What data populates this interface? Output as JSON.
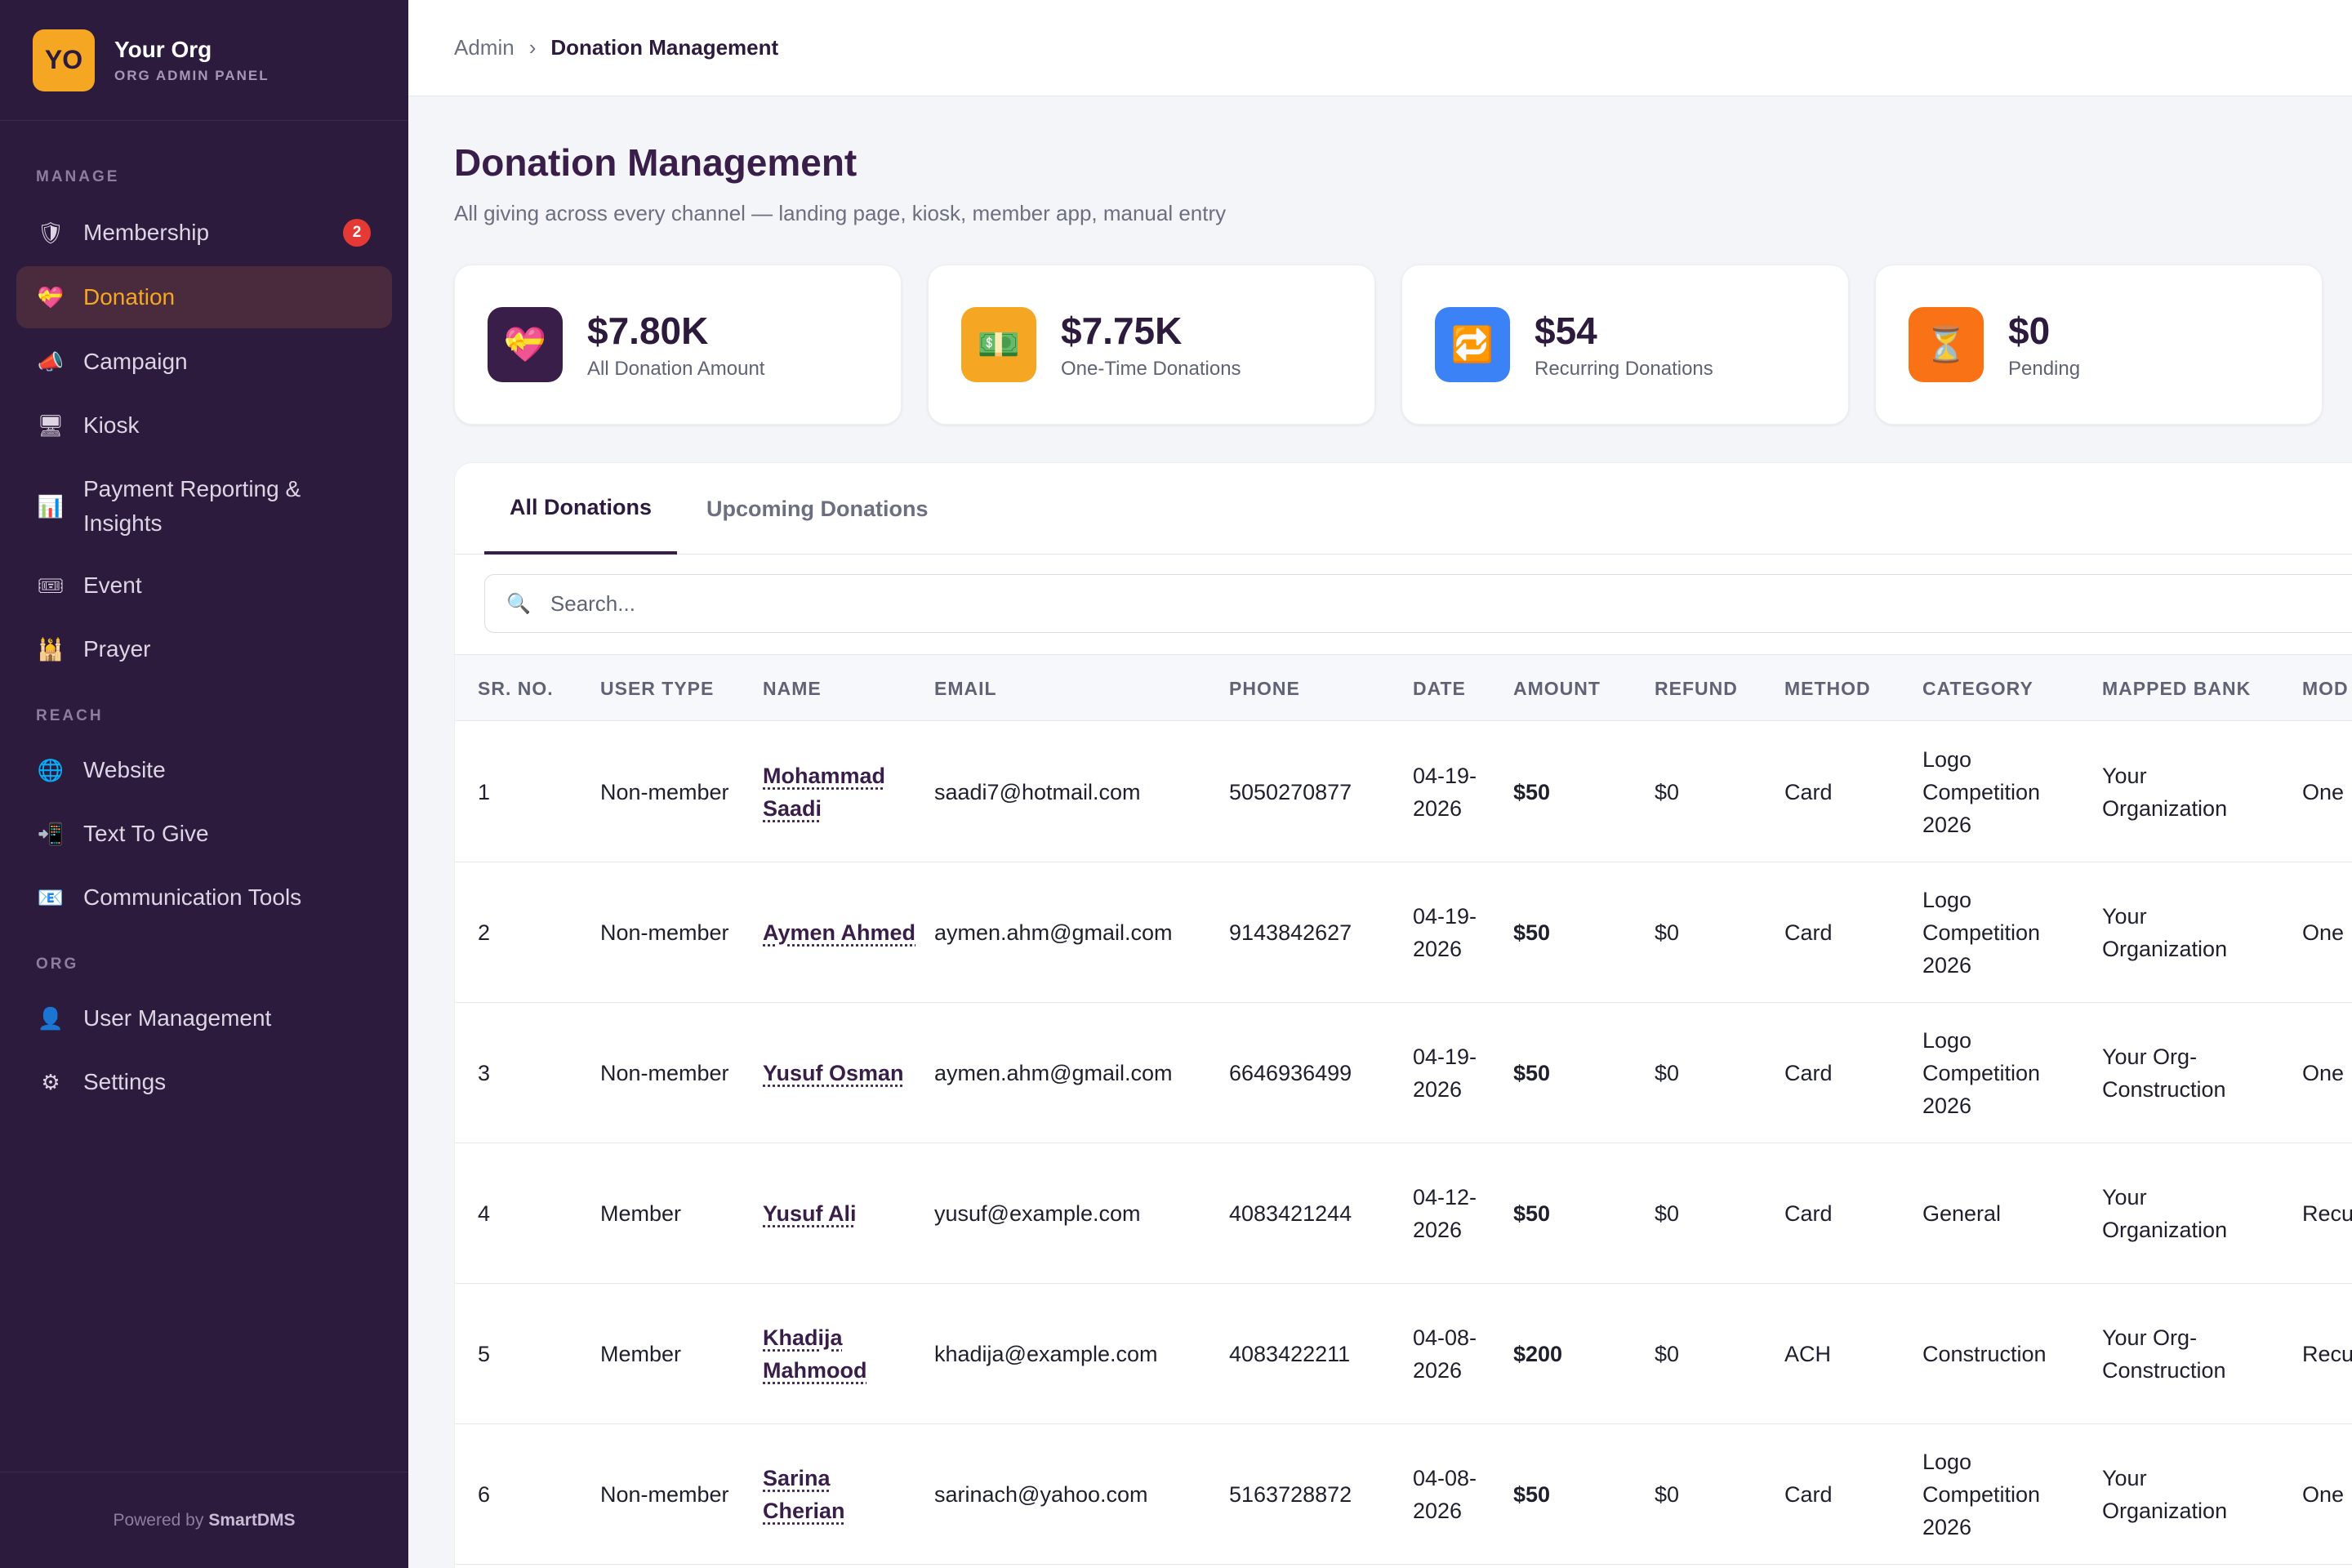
{
  "brand": {
    "logo": "YO",
    "name": "Your Org",
    "subtitle": "ORG ADMIN PANEL"
  },
  "sidebar": {
    "sections": [
      {
        "label": "MANAGE"
      },
      {
        "label": "REACH"
      },
      {
        "label": "ORG"
      }
    ],
    "items": [
      {
        "label": "Membership",
        "icon": "shield-icon",
        "glyph": "🛡",
        "badge": "2",
        "active": false
      },
      {
        "label": "Donation",
        "icon": "heart-gift-icon",
        "glyph": "💝",
        "active": true
      },
      {
        "label": "Campaign",
        "icon": "megaphone-icon",
        "glyph": "📣",
        "active": false
      },
      {
        "label": "Kiosk",
        "icon": "monitor-icon",
        "glyph": "🖥",
        "active": false
      },
      {
        "label": "Payment Reporting & Insights",
        "icon": "bar-chart-icon",
        "glyph": "📊",
        "active": false
      },
      {
        "label": "Event",
        "icon": "ticket-icon",
        "glyph": "🎟",
        "active": false
      },
      {
        "label": "Prayer",
        "icon": "mosque-icon",
        "glyph": "🕌",
        "active": false
      },
      {
        "label": "Website",
        "icon": "globe-icon",
        "glyph": "🌐",
        "active": false
      },
      {
        "label": "Text To Give",
        "icon": "phone-message-icon",
        "glyph": "📲",
        "active": false
      },
      {
        "label": "Communication Tools",
        "icon": "mail-icon",
        "glyph": "📧",
        "active": false
      },
      {
        "label": "User Management",
        "icon": "user-icon",
        "glyph": "👤",
        "active": false
      },
      {
        "label": "Settings",
        "icon": "gear-icon",
        "glyph": "⚙",
        "active": false
      }
    ],
    "footer_prefix": "Powered by",
    "footer_brand": "SmartDMS"
  },
  "breadcrumb": {
    "root": "Admin",
    "separator": "›",
    "current": "Donation Management"
  },
  "page": {
    "title": "Donation Management",
    "subtitle": "All giving across every channel — landing page, kiosk, member app, manual entry"
  },
  "stats": [
    {
      "value": "$7.80K",
      "label": "All Donation Amount",
      "icon": "heart-gift-icon",
      "glyph": "💝",
      "color": "#3a1e4a"
    },
    {
      "value": "$7.75K",
      "label": "One-Time Donations",
      "icon": "money-icon",
      "glyph": "💵",
      "color": "#f5a623"
    },
    {
      "value": "$54",
      "label": "Recurring Donations",
      "icon": "repeat-icon",
      "glyph": "🔁",
      "color": "#3b82f6"
    },
    {
      "value": "$0",
      "label": "Pending",
      "icon": "hourglass-icon",
      "glyph": "⏳",
      "color": "#f97316"
    }
  ],
  "tabs": [
    {
      "label": "All Donations",
      "active": true
    },
    {
      "label": "Upcoming Donations",
      "active": false
    }
  ],
  "search": {
    "placeholder": "Search...",
    "value": ""
  },
  "table": {
    "columns": [
      "SR. NO.",
      "USER TYPE",
      "NAME",
      "EMAIL",
      "PHONE",
      "DATE",
      "AMOUNT",
      "REFUND",
      "METHOD",
      "CATEGORY",
      "MAPPED BANK",
      "MOD"
    ],
    "rows": [
      {
        "sr": "1",
        "user_type": "Non-member",
        "name": "Mohammad Saadi",
        "email": "saadi7@hotmail.com",
        "phone": "5050270877",
        "date": "04-19-2026",
        "amount": "$50",
        "refund": "$0",
        "method": "Card",
        "category": "Logo Competition 2026",
        "bank": "Your Organization",
        "mode": "One"
      },
      {
        "sr": "2",
        "user_type": "Non-member",
        "name": "Aymen Ahmed",
        "email": "aymen.ahm@gmail.com",
        "phone": "9143842627",
        "date": "04-19-2026",
        "amount": "$50",
        "refund": "$0",
        "method": "Card",
        "category": "Logo Competition 2026",
        "bank": "Your Organization",
        "mode": "One"
      },
      {
        "sr": "3",
        "user_type": "Non-member",
        "name": "Yusuf Osman",
        "email": "aymen.ahm@gmail.com",
        "phone": "6646936499",
        "date": "04-19-2026",
        "amount": "$50",
        "refund": "$0",
        "method": "Card",
        "category": "Logo Competition 2026",
        "bank": "Your Org-Construction",
        "mode": "One"
      },
      {
        "sr": "4",
        "user_type": "Member",
        "name": "Yusuf Ali",
        "email": "yusuf@example.com",
        "phone": "4083421244",
        "date": "04-12-2026",
        "amount": "$50",
        "refund": "$0",
        "method": "Card",
        "category": "General",
        "bank": "Your Organization",
        "mode": "Recu"
      },
      {
        "sr": "5",
        "user_type": "Member",
        "name": "Khadija Mahmood",
        "email": "khadija@example.com",
        "phone": "4083422211",
        "date": "04-08-2026",
        "amount": "$200",
        "refund": "$0",
        "method": "ACH",
        "category": "Construction",
        "bank": "Your Org-Construction",
        "mode": "Recu"
      },
      {
        "sr": "6",
        "user_type": "Non-member",
        "name": "Sarina Cherian",
        "email": "sarinach@yahoo.com",
        "phone": "5163728872",
        "date": "04-08-2026",
        "amount": "$50",
        "refund": "$0",
        "method": "Card",
        "category": "Logo Competition 2026",
        "bank": "Your Organization",
        "mode": "One"
      }
    ]
  }
}
